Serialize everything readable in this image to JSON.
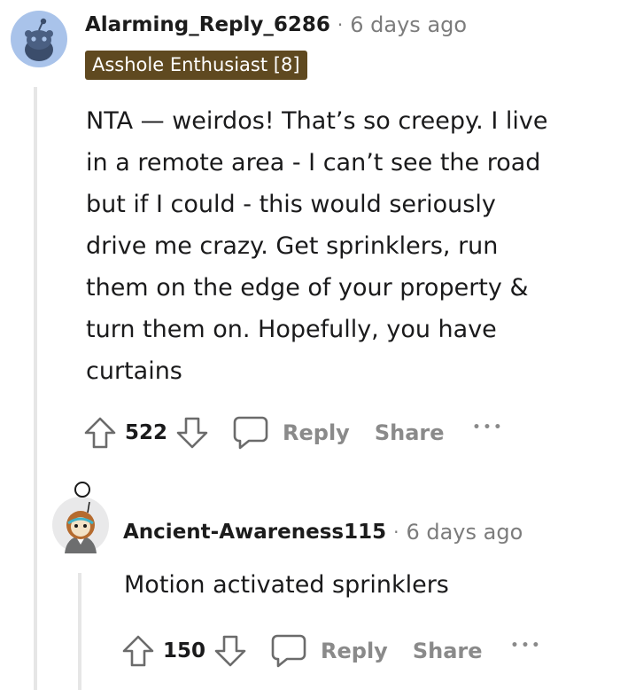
{
  "comment": {
    "username": "Alarming_Reply_6286",
    "separator": "·",
    "timestamp": "6 days ago",
    "flair": "Asshole Enthusiast [8]",
    "body_lines": [
      "NTA — weirdos! That’s so creepy. I live",
      "in a remote area - I can’t see the road",
      "but if I could - this would seriously",
      "drive me crazy. Get sprinklers, run",
      "them on the edge of your property &",
      "turn them on. Hopefully, you have",
      "curtains"
    ],
    "score": "522",
    "reply_label": "Reply",
    "share_label": "Share",
    "more_label": "•••"
  },
  "reply": {
    "username": "Ancient-Awareness115",
    "separator": "·",
    "timestamp": "6 days ago",
    "body": "Motion activated sprinklers",
    "score": "150",
    "reply_label": "Reply",
    "share_label": "Share",
    "more_label": "•••"
  },
  "colors": {
    "flair_bg": "#5f4920",
    "avatar1_bg": "#a9c3ea",
    "action_gray": "#8a8a8a",
    "thread_line": "#e6e6e6"
  },
  "icons": [
    "reddit-snoo-avatar-icon",
    "reddit-custom-avatar-icon",
    "upvote-icon",
    "downvote-icon",
    "comment-bubble-icon"
  ]
}
